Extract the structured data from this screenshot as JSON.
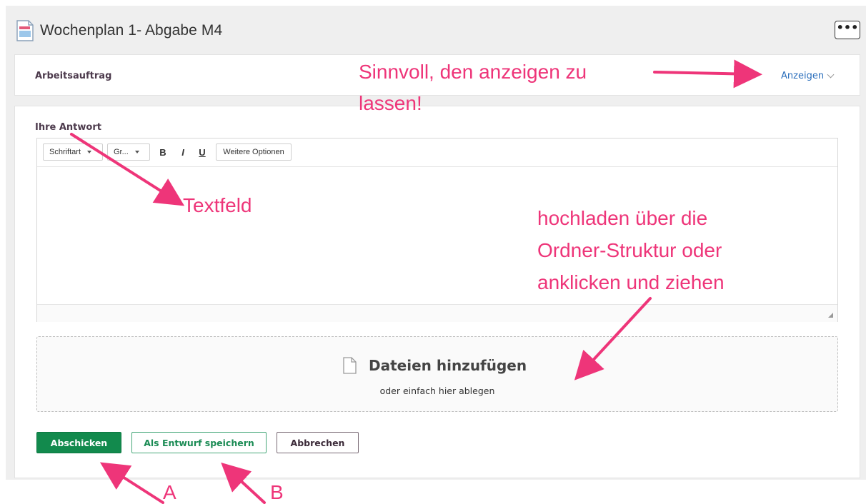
{
  "header": {
    "title": "Wochenplan 1- Abgabe M4",
    "more_button": "•••"
  },
  "task_section": {
    "title": "Arbeitsauftrag",
    "show_link": "Anzeigen"
  },
  "answer_section": {
    "label": "Ihre Antwort",
    "toolbar": {
      "font": "Schriftart",
      "size": "Gr...",
      "bold": "B",
      "italic": "I",
      "underline": "U",
      "more": "Weitere Optionen"
    }
  },
  "dropzone": {
    "title": "Dateien hinzufügen",
    "subtitle": "oder einfach hier ablegen"
  },
  "buttons": {
    "submit": "Abschicken",
    "draft": "Als Entwurf speichern",
    "cancel": "Abbrechen"
  },
  "annotations": {
    "show_note_line1": "Sinnvoll, den anzeigen zu",
    "show_note_line2": "lassen!",
    "textfield": "Textfeld",
    "upload_line1": "hochladen über die",
    "upload_line2": "Ordner-Struktur oder",
    "upload_line3": "anklicken und ziehen",
    "label_a": "A",
    "label_b": "B"
  },
  "colors": {
    "annotation": "#ee3579",
    "submit_green": "#128a4d",
    "link_blue": "#2a6ebb",
    "heading_purple": "#4d3b4d"
  },
  "icons": [
    "document-icon",
    "more-icon",
    "chevron-down-icon",
    "file-icon",
    "resize-handle-icon"
  ]
}
